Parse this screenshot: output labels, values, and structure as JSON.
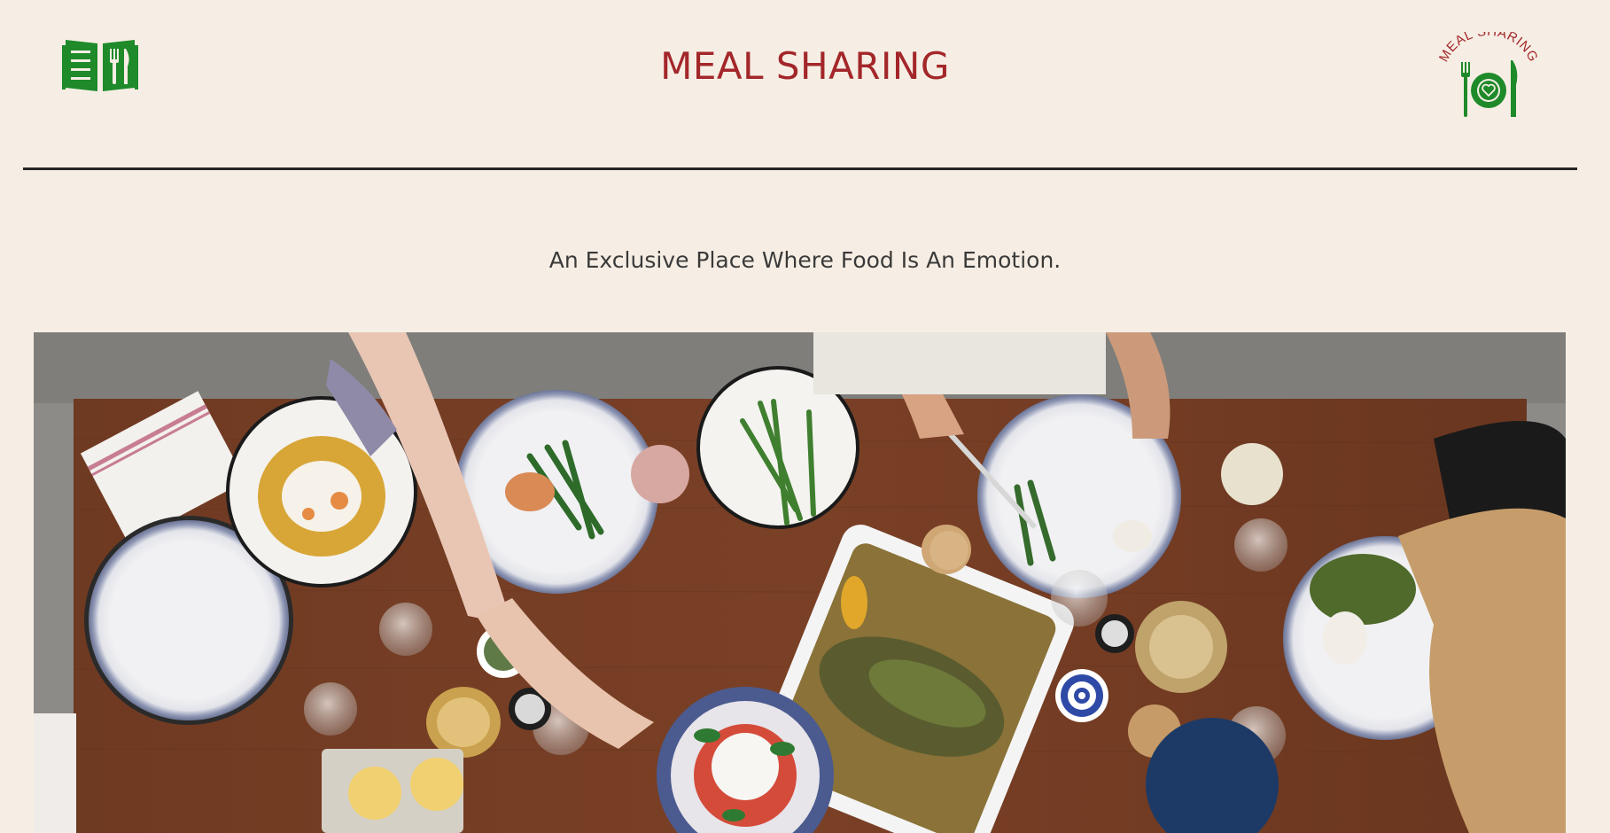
{
  "header": {
    "title": "MEAL SHARING",
    "menu_icon": "menu-book-icon",
    "brand_logo_text": "MEAL SHARING",
    "brand_logo_icon": "plate-heart-cutlery-icon"
  },
  "main": {
    "tagline": "An Exclusive Place Where Food Is An Emotion.",
    "hero_image": "overhead-dining-table-photo"
  },
  "colors": {
    "background": "#f6eee4",
    "title": "#a3272a",
    "icon_green": "#1e8a2a",
    "divider": "#262626",
    "tagline": "#3a3a3a"
  }
}
